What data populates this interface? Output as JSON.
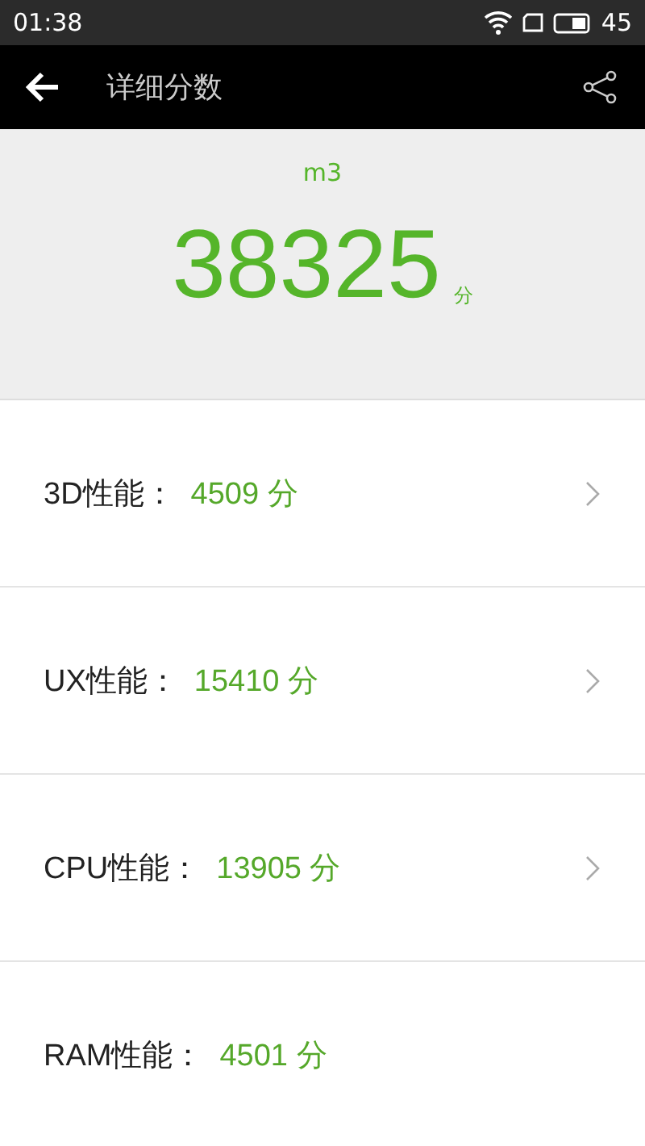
{
  "status_bar": {
    "time": "01:38",
    "battery_text": "45"
  },
  "app_bar": {
    "title": "详细分数"
  },
  "summary": {
    "device": "m3",
    "score": "38325",
    "unit": "分"
  },
  "rows": [
    {
      "label": "3D性能：",
      "score": "4509 分",
      "has_detail": true
    },
    {
      "label": "UX性能：",
      "score": "15410 分",
      "has_detail": true
    },
    {
      "label": "CPU性能：",
      "score": "13905 分",
      "has_detail": true
    },
    {
      "label": "RAM性能：",
      "score": "4501 分",
      "has_detail": false
    }
  ]
}
